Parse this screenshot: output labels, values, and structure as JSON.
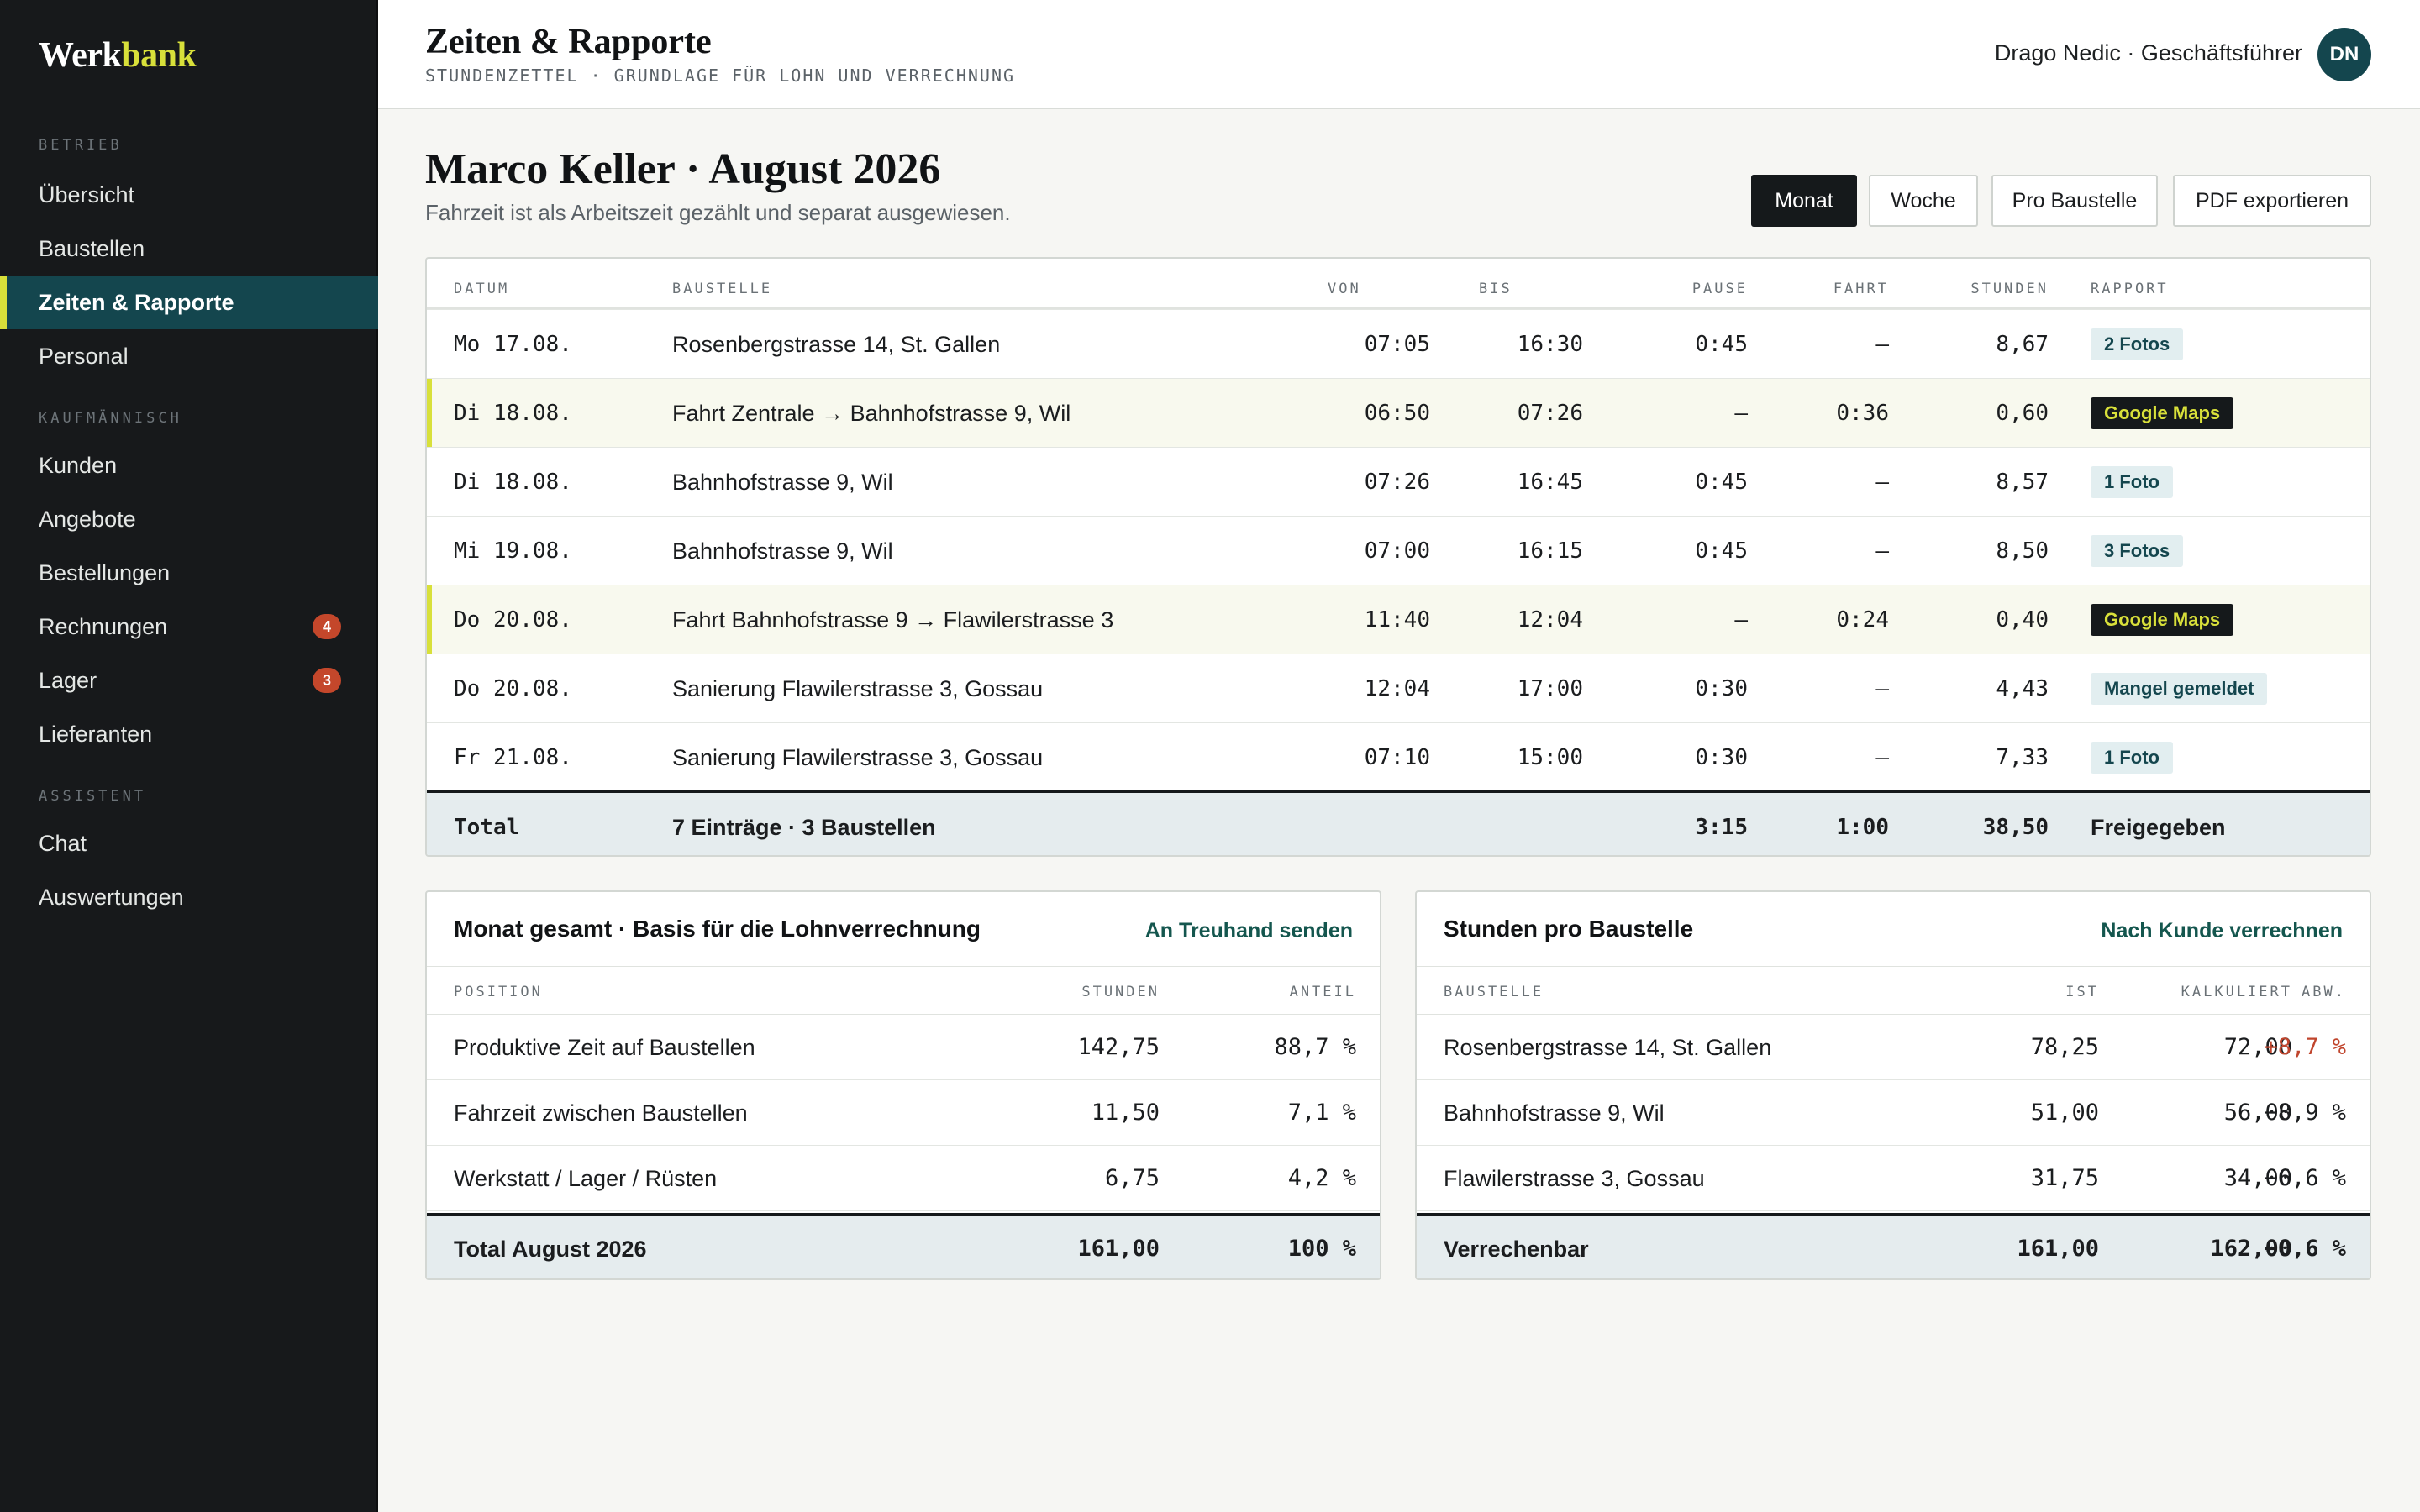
{
  "brand": {
    "part1": "Werk",
    "part2": "bank"
  },
  "sidebar": {
    "sections": [
      {
        "label": "BETRIEB"
      },
      {
        "label": "KAUFMÄNNISCH"
      },
      {
        "label": "ASSISTENT"
      }
    ],
    "items": [
      {
        "label": "Übersicht"
      },
      {
        "label": "Baustellen"
      },
      {
        "label": "Zeiten & Rapporte"
      },
      {
        "label": "Personal"
      },
      {
        "label": "Kunden"
      },
      {
        "label": "Angebote"
      },
      {
        "label": "Bestellungen"
      },
      {
        "label": "Rechnungen",
        "badge": "4"
      },
      {
        "label": "Lager",
        "badge": "3"
      },
      {
        "label": "Lieferanten"
      },
      {
        "label": "Chat"
      },
      {
        "label": "Auswertungen"
      }
    ],
    "active_item": "Zeiten & Rapporte"
  },
  "header": {
    "title": "Zeiten & Rapporte",
    "subtitle": "STUNDENZETTEL · GRUNDLAGE FÜR LOHN UND VERRECHNUNG",
    "user": "Drago Nedic · Geschäftsführer",
    "avatar": "DN"
  },
  "main": {
    "title": "Marco Keller · August 2026",
    "note": "Fahrzeit ist als Arbeitszeit gezählt und separat ausgewiesen.",
    "buttons": {
      "month": "Monat",
      "week": "Woche",
      "site": "Pro Baustelle",
      "pdf": "PDF exportieren"
    },
    "active_button": "Monat"
  },
  "entries": {
    "columns": [
      "DATUM",
      "BAUSTELLE",
      "VON",
      "BIS",
      "PAUSE",
      "FAHRT",
      "STUNDEN",
      "RAPPORT"
    ],
    "rows": [
      {
        "date": "Mo 17.08.",
        "site": "Rosenbergstrasse 14, St. Gallen",
        "from": "07:05",
        "to": "16:30",
        "pause": "0:45",
        "travel": "–",
        "hours": "8,67",
        "report": "2 Fotos",
        "kind": "work"
      },
      {
        "date": "Di 18.08.",
        "site": "Fahrt Zentrale → Bahnhofstrasse 9, Wil",
        "from": "06:50",
        "to": "07:26",
        "pause": "–",
        "travel": "0:36",
        "hours": "0,60",
        "report": "Google Maps",
        "kind": "travel"
      },
      {
        "date": "Di 18.08.",
        "site": "Bahnhofstrasse 9, Wil",
        "from": "07:26",
        "to": "16:45",
        "pause": "0:45",
        "travel": "–",
        "hours": "8,57",
        "report": "1 Foto",
        "kind": "work"
      },
      {
        "date": "Mi 19.08.",
        "site": "Bahnhofstrasse 9, Wil",
        "from": "07:00",
        "to": "16:15",
        "pause": "0:45",
        "travel": "–",
        "hours": "8,50",
        "report": "3 Fotos",
        "kind": "work"
      },
      {
        "date": "Do 20.08.",
        "site": "Fahrt Bahnhofstrasse 9 → Flawilerstrasse 3",
        "from": "11:40",
        "to": "12:04",
        "pause": "–",
        "travel": "0:24",
        "hours": "0,40",
        "report": "Google Maps",
        "kind": "travel"
      },
      {
        "date": "Do 20.08.",
        "site": "Sanierung Flawilerstrasse 3, Gossau",
        "from": "12:04",
        "to": "17:00",
        "pause": "0:30",
        "travel": "–",
        "hours": "4,43",
        "report": "Mangel gemeldet",
        "kind": "work"
      },
      {
        "date": "Fr 21.08.",
        "site": "Sanierung Flawilerstrasse 3, Gossau",
        "from": "07:10",
        "to": "15:00",
        "pause": "0:30",
        "travel": "–",
        "hours": "7,33",
        "report": "1 Foto",
        "kind": "work"
      }
    ],
    "total": {
      "label": "Total",
      "summary": "7 Einträge · 3 Baustellen",
      "pause": "3:15",
      "travel": "1:00",
      "hours": "38,50",
      "status": "Freigegeben"
    }
  },
  "payroll": {
    "title": "Monat gesamt · Basis für die Lohnverrechnung",
    "link": "An Treuhand senden",
    "columns": [
      "POSITION",
      "STUNDEN",
      "ANTEIL"
    ],
    "rows": [
      {
        "position": "Produktive Zeit auf Baustellen",
        "hours": "142,75",
        "share": "88,7 %"
      },
      {
        "position": "Fahrzeit zwischen Baustellen",
        "hours": "11,50",
        "share": "7,1 %"
      },
      {
        "position": "Werkstatt / Lager / Rüsten",
        "hours": "6,75",
        "share": "4,2 %"
      }
    ],
    "total": {
      "label": "Total August 2026",
      "hours": "161,00",
      "share": "100 %"
    }
  },
  "sites": {
    "title": "Stunden pro Baustelle",
    "link": "Nach Kunde verrechnen",
    "columns": [
      "BAUSTELLE",
      "IST",
      "KALKULIERT",
      "ABW."
    ],
    "rows": [
      {
        "site": "Rosenbergstrasse 14, St. Gallen",
        "actual": "78,25",
        "planned": "72,00",
        "dev": "+8,7 %",
        "over": true
      },
      {
        "site": "Bahnhofstrasse 9, Wil",
        "actual": "51,00",
        "planned": "56,00",
        "dev": "−8,9 %",
        "over": false
      },
      {
        "site": "Flawilerstrasse 3, Gossau",
        "actual": "31,75",
        "planned": "34,00",
        "dev": "−6,6 %",
        "over": false
      }
    ],
    "total": {
      "label": "Verrechenbar",
      "actual": "161,00",
      "planned": "162,00",
      "dev": "−0,6 %"
    }
  },
  "colors": {
    "accent": "#d8e03a",
    "brand": "#14464e",
    "sidebar_bg": "#17191b",
    "badge": "#c4472b",
    "over_budget": "#c0452d"
  }
}
